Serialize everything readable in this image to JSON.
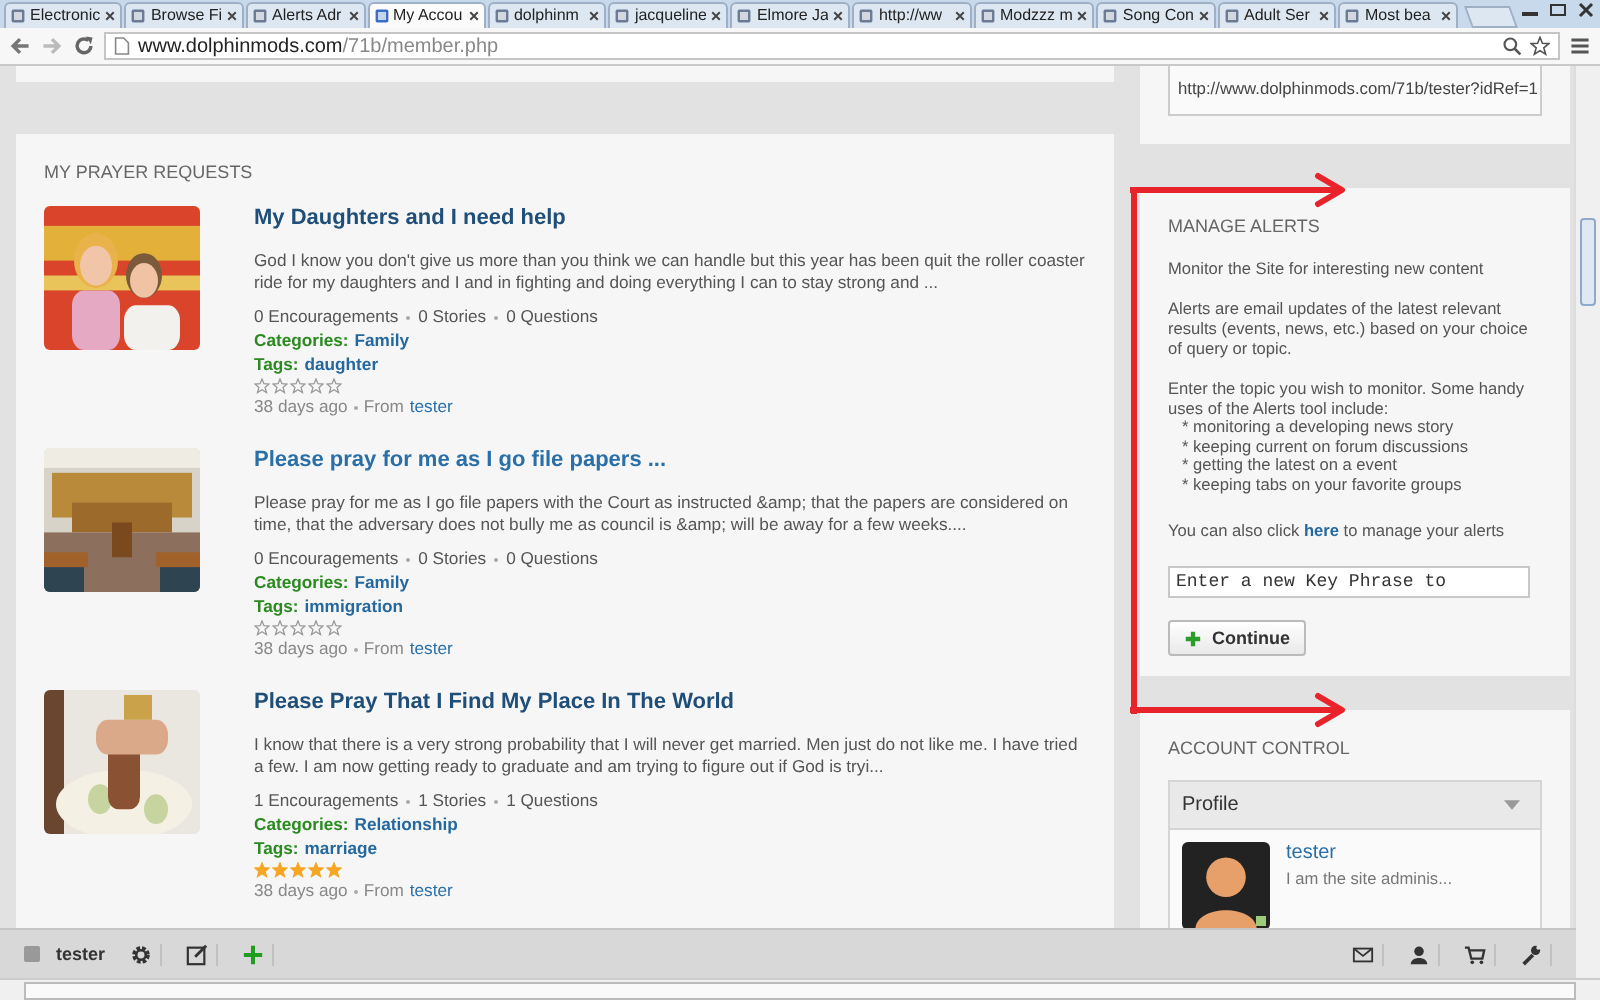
{
  "browser": {
    "tabs": [
      {
        "title": "Electronic",
        "selected": false
      },
      {
        "title": "Browse Fi",
        "selected": false
      },
      {
        "title": "Alerts Adr",
        "selected": false
      },
      {
        "title": "My Accou",
        "selected": true
      },
      {
        "title": "dolphinm",
        "selected": false
      },
      {
        "title": "jacqueline",
        "selected": false
      },
      {
        "title": "Elmore Ja",
        "selected": false
      },
      {
        "title": "http://ww",
        "selected": false
      },
      {
        "title": "Modzzz m",
        "selected": false
      },
      {
        "title": "Song Con",
        "selected": false
      },
      {
        "title": "Adult Ser",
        "selected": false
      },
      {
        "title": "Most bea",
        "selected": false
      }
    ],
    "url_domain": "www.dolphinmods.com",
    "url_path": "/71b/member.php"
  },
  "prayer_requests": {
    "heading": "MY PRAYER REQUESTS",
    "items": [
      {
        "title": "My Daughters and I need help",
        "excerpt": "God I know you don't give us more than you think we can handle but this year has been quit the roller coaster ride for my daughters and I and in fighting and doing everything I can to stay strong and ...",
        "stats": [
          "0 Encouragements",
          "0 Stories",
          "0 Questions"
        ],
        "category_label": "Categories:",
        "category": "Family",
        "tags_label": "Tags:",
        "tag": "daughter",
        "stars": 0,
        "age": "38 days ago",
        "from_label": "From",
        "author": "tester",
        "kind": "picture"
      },
      {
        "title": "Please pray for me as I go file papers ...",
        "excerpt": "Please pray for me as I go file papers with the Court as instructed &amp; that the papers are considered on time, that the adversary does not bully me as council is &amp; will be away for a few weeks....",
        "stats": [
          "0 Encouragements",
          "0 Stories",
          "0 Questions"
        ],
        "category_label": "Categories:",
        "category": "Family",
        "tags_label": "Tags:",
        "tag": "immigration",
        "stars": 0,
        "age": "38 days ago",
        "from_label": "From",
        "author": "tester",
        "kind": "picture"
      },
      {
        "title": "Please Pray That I Find My Place In The World",
        "excerpt": "I know that there is a very strong probability that I will never get married. Men just do not like me. I have tried a few. I am now getting ready to graduate and am trying to figure out if God is tryi...",
        "stats": [
          "1 Encouragements",
          "1 Stories",
          "1 Questions"
        ],
        "category_label": "Categories:",
        "category": "Relationship",
        "tags_label": "Tags:",
        "tag": "marriage",
        "stars": 5,
        "age": "38 days ago",
        "from_label": "From",
        "author": "tester",
        "kind": "picture"
      }
    ]
  },
  "share_link": {
    "value": "http://www.dolphinmods.com/71b/tester?idRef=1"
  },
  "manage_alerts": {
    "heading": "MANAGE ALERTS",
    "intro": "Monitor the Site for interesting new content",
    "paragraphs": [
      "Alerts are email updates of the latest relevant results (events, news, etc.) based on your choice of query or topic.",
      "Enter the topic you wish to monitor. Some handy uses of the Alerts tool include:"
    ],
    "uses": [
      "* monitoring a developing news story",
      "* keeping current on forum discussions",
      "* getting the latest on a event",
      "* keeping tabs on your favorite groups"
    ],
    "manage_before": "You can also click",
    "manage_link": "here",
    "manage_after": "to manage your alerts",
    "placeholder": "Enter a new Key Phrase to",
    "button": "Continue"
  },
  "account_control": {
    "heading": "ACCOUNT CONTROL",
    "panel_title": "Profile",
    "user": "tester",
    "status": "I am the site adminis...",
    "online": true
  },
  "toolbar": {
    "user": "tester"
  }
}
